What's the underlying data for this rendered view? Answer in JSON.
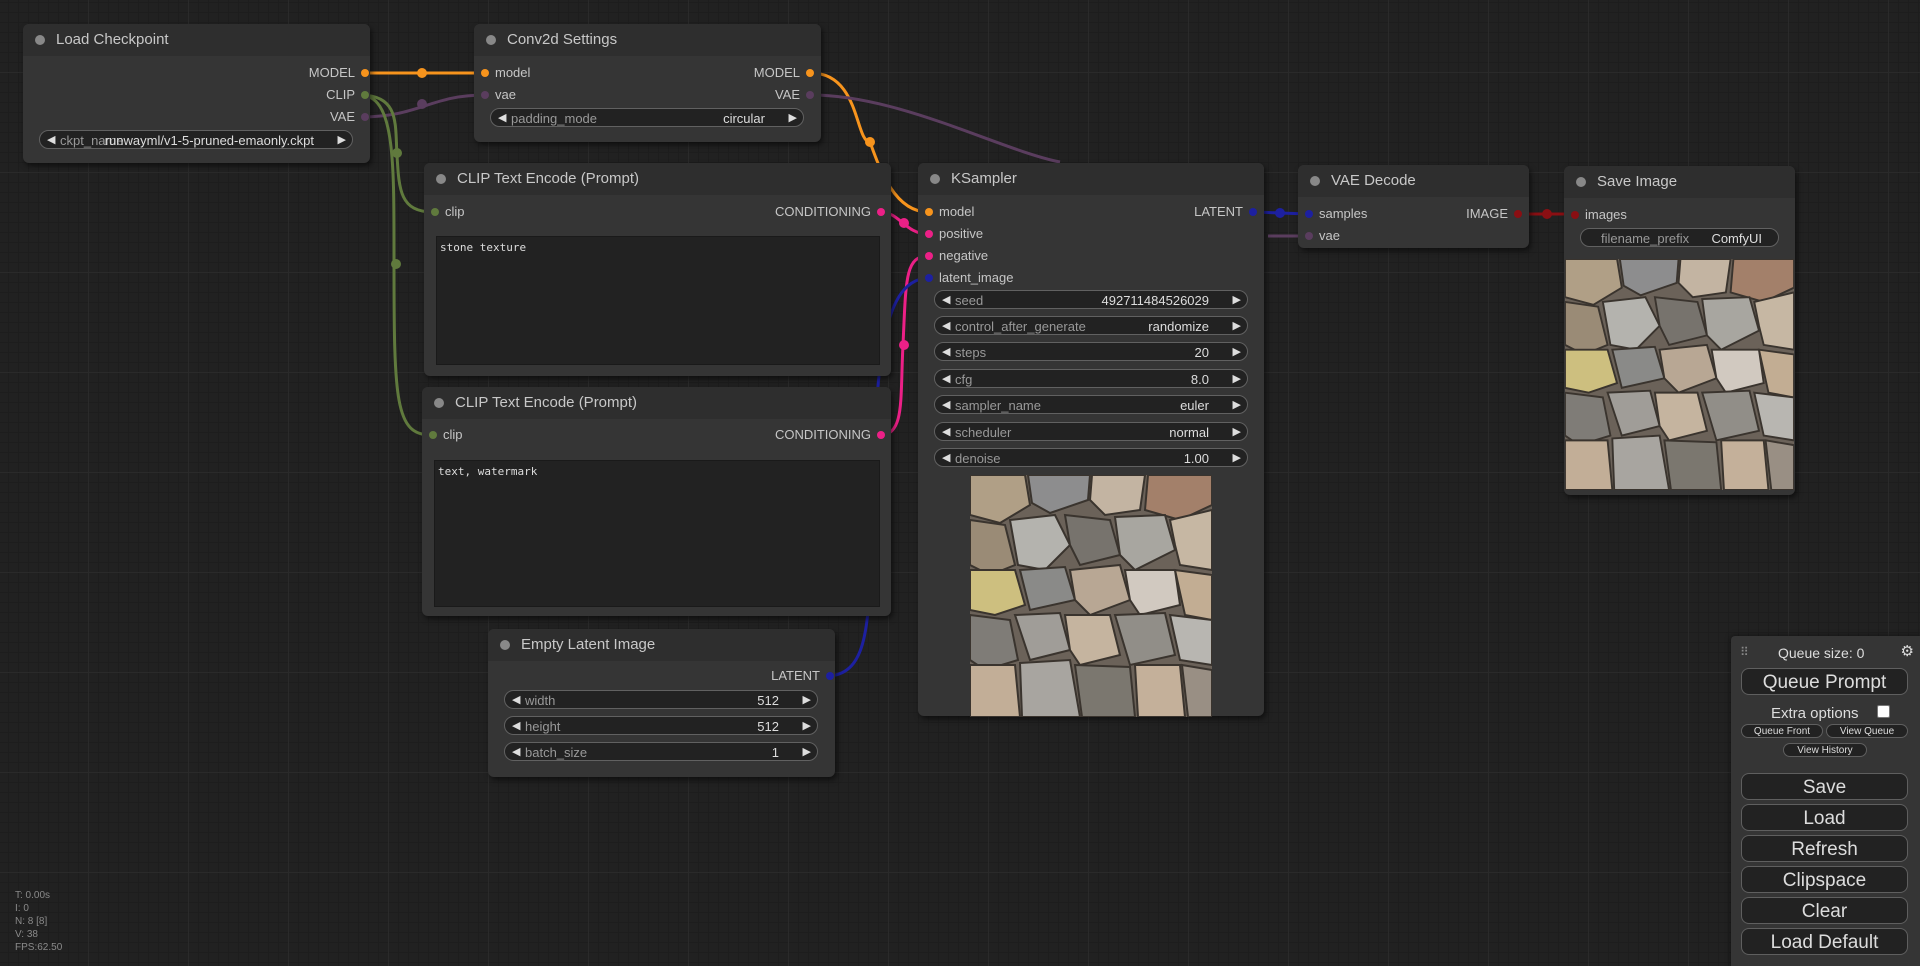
{
  "colors": {
    "model": "#f7941d",
    "clip": "#607a3d",
    "vae": "#5a3d5e",
    "conditioning": "#ec2087",
    "latent": "#1d20a0",
    "image": "#8a0f13"
  },
  "nodes": {
    "load_checkpoint": {
      "title": "Load Checkpoint",
      "outputs": [
        "MODEL",
        "CLIP",
        "VAE"
      ],
      "widget": {
        "label": "ckpt_name",
        "value": "runwayml/v1-5-pruned-emaonly.ckpt"
      }
    },
    "conv2d_settings": {
      "title": "Conv2d Settings",
      "inputs": [
        "model",
        "vae"
      ],
      "outputs": [
        "MODEL",
        "VAE"
      ],
      "widget": {
        "label": "padding_mode",
        "value": "circular"
      }
    },
    "clip_text_pos": {
      "title": "CLIP Text Encode (Prompt)",
      "input": "clip",
      "output": "CONDITIONING",
      "text": "stone texture"
    },
    "clip_text_neg": {
      "title": "CLIP Text Encode (Prompt)",
      "input": "clip",
      "output": "CONDITIONING",
      "text": "text, watermark"
    },
    "empty_latent": {
      "title": "Empty Latent Image",
      "output": "LATENT",
      "widgets": [
        {
          "label": "width",
          "value": "512"
        },
        {
          "label": "height",
          "value": "512"
        },
        {
          "label": "batch_size",
          "value": "1"
        }
      ]
    },
    "ksampler": {
      "title": "KSampler",
      "inputs": [
        "model",
        "positive",
        "negative",
        "latent_image"
      ],
      "output": "LATENT",
      "widgets": [
        {
          "label": "seed",
          "value": "492711484526029"
        },
        {
          "label": "control_after_generate",
          "value": "randomize"
        },
        {
          "label": "steps",
          "value": "20"
        },
        {
          "label": "cfg",
          "value": "8.0"
        },
        {
          "label": "sampler_name",
          "value": "euler"
        },
        {
          "label": "scheduler",
          "value": "normal"
        },
        {
          "label": "denoise",
          "value": "1.00"
        }
      ]
    },
    "vae_decode": {
      "title": "VAE Decode",
      "inputs": [
        "samples",
        "vae"
      ],
      "output": "IMAGE"
    },
    "save_image": {
      "title": "Save Image",
      "input": "images",
      "widget": {
        "label": "filename_prefix",
        "value": "ComfyUI"
      }
    }
  },
  "panel": {
    "queue_size": "Queue size: 0",
    "queue_prompt": "Queue Prompt",
    "extra_options": "Extra options",
    "queue_front": "Queue Front",
    "view_queue": "View Queue",
    "view_history": "View History",
    "save": "Save",
    "load": "Load",
    "refresh": "Refresh",
    "clipspace": "Clipspace",
    "clear": "Clear",
    "load_default": "Load Default"
  },
  "stats": {
    "t": "T: 0.00s",
    "i": "I: 0",
    "n": "N: 8 [8]",
    "v": "V: 38",
    "fps": "FPS:62.50"
  }
}
